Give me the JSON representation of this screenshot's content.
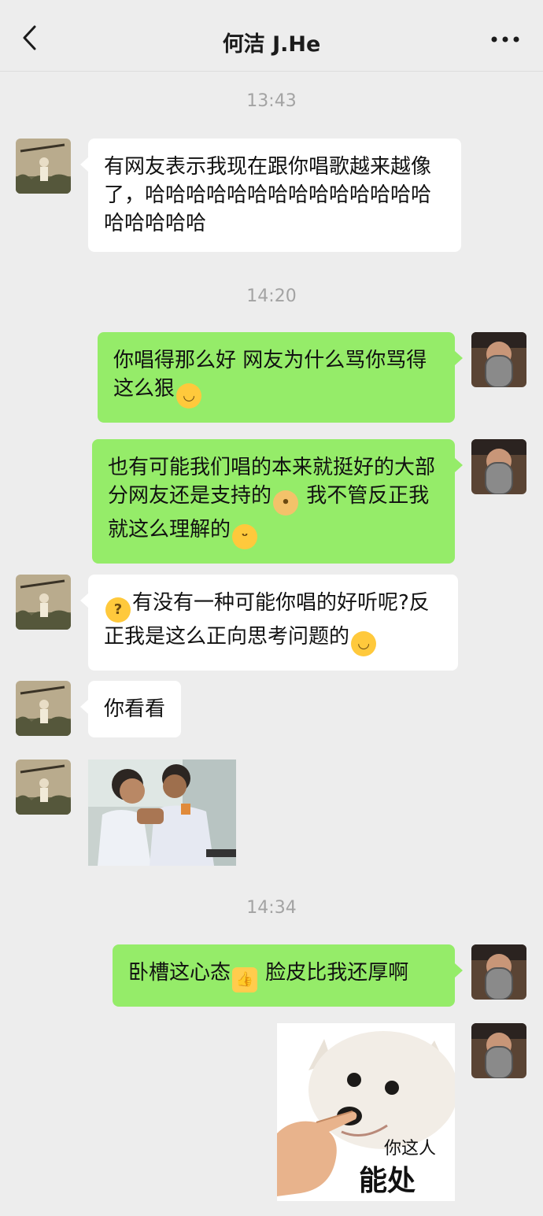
{
  "header": {
    "title": "何洁 J.He",
    "back_icon": "chevron-left-icon",
    "more_icon": "more-dots-icon"
  },
  "colors": {
    "background": "#ededed",
    "received_bubble": "#ffffff",
    "sent_bubble": "#95ec69",
    "timestamp": "#a3a3a3"
  },
  "timestamps": [
    "13:43",
    "14:20",
    "14:34"
  ],
  "messages": [
    {
      "side": "left",
      "text": "有网友表示我现在跟你唱歌越来越像了，哈哈哈哈哈哈哈哈哈哈哈哈哈哈哈哈哈哈哈"
    },
    {
      "side": "right",
      "text_a": "你唱得那么好 网友为什么骂你骂得这么狠",
      "emoji": "smile-emoji"
    },
    {
      "side": "right",
      "text_a": "也有可能我们唱的本来就挺好的大部分网友还是支持的",
      "emoji_1": "doge-emoji",
      "text_b": " 我不管反正我就这么理解的",
      "emoji_2": "hug-emoji"
    },
    {
      "side": "left",
      "emoji_1": "thinking-emoji",
      "text_a": "有没有一种可能你唱的好听呢?反正我是这么正向思考问题的",
      "emoji_2": "smile-emoji"
    },
    {
      "side": "left",
      "text": "你看看"
    },
    {
      "side": "left",
      "type": "image",
      "alt": "two-boys-laughing-photo"
    },
    {
      "side": "right",
      "text_a": "卧槽这心态",
      "emoji": "thumbs-up-emoji",
      "text_b": " 脸皮比我还厚啊"
    },
    {
      "side": "right",
      "type": "sticker",
      "line1": "你这人",
      "line2": "能处"
    }
  ]
}
